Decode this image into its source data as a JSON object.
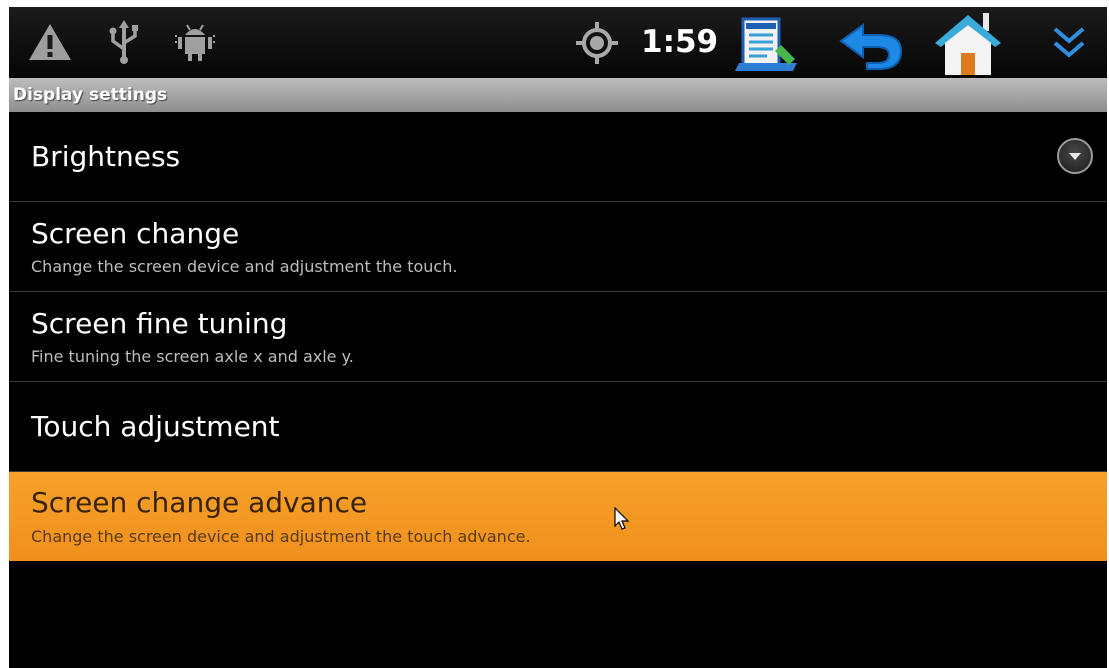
{
  "status_bar": {
    "icons_left": [
      "warning-icon",
      "usb-icon",
      "android-debug-icon"
    ],
    "icons_right": [
      "gps-icon",
      "notes-app-icon",
      "back-arrow-icon",
      "home-icon",
      "chevron-double-down-icon"
    ],
    "time": "1:59"
  },
  "title_bar": {
    "title": "Display settings"
  },
  "items": [
    {
      "title": "Brightness",
      "summary": "",
      "control": "dropdown-arrow-icon"
    },
    {
      "title": "Screen change",
      "summary": "Change the screen device and adjustment the touch."
    },
    {
      "title": "Screen fine tuning",
      "summary": "Fine tuning the screen axle x and axle y."
    },
    {
      "title": "Touch adjustment",
      "summary": ""
    },
    {
      "title": "Screen change advance",
      "summary": "Change the screen device and adjustment the touch advance.",
      "selected": true
    }
  ],
  "colors": {
    "background": "#000000",
    "title_bar": "#a8a8a8",
    "selected_item": "#f29a22",
    "divider": "#3a3a3a",
    "back_icon": "#1e88e5"
  }
}
